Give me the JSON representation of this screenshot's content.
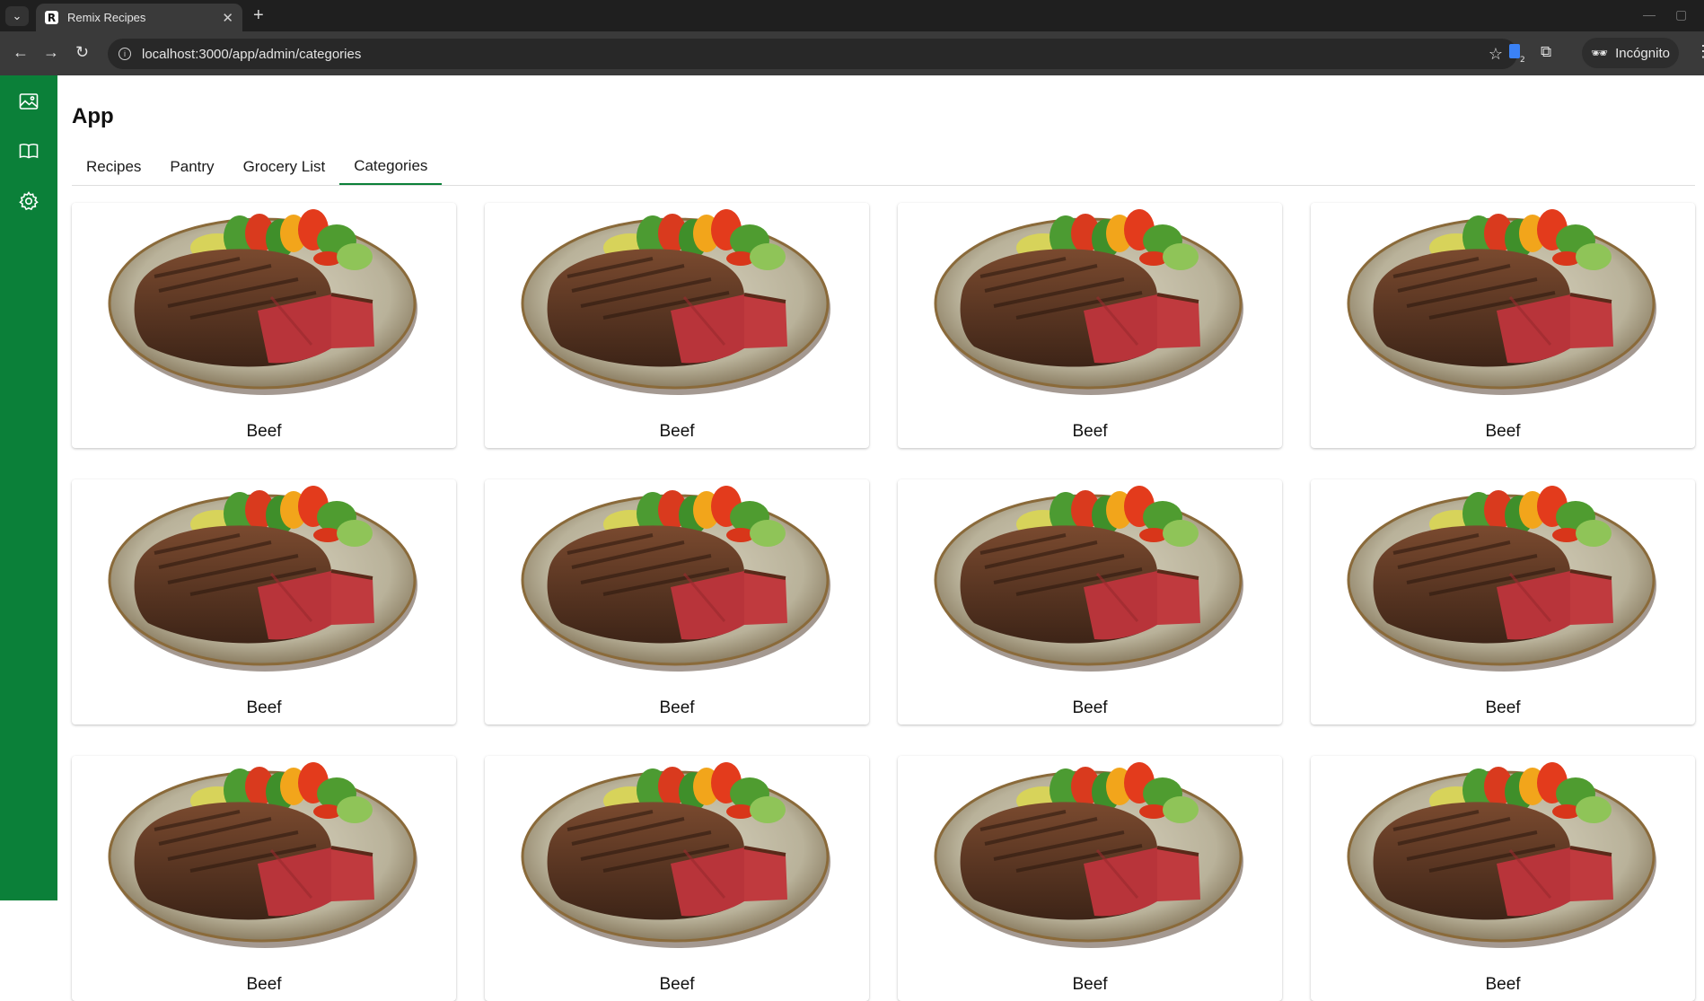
{
  "browser": {
    "tab_title": "Remix Recipes",
    "favicon_letter": "R",
    "url": "localhost:3000/app/admin/categories",
    "profile_label": "Incógnito",
    "extension_badge": "2"
  },
  "app": {
    "title": "App",
    "tabs": [
      {
        "label": "Recipes"
      },
      {
        "label": "Pantry"
      },
      {
        "label": "Grocery List"
      },
      {
        "label": "Categories",
        "active": true
      }
    ],
    "accent_color": "#0b8039"
  },
  "sidebar": {
    "icons": [
      "image-icon",
      "book-icon",
      "gear-icon"
    ]
  },
  "categories": [
    {
      "name": "Beef"
    },
    {
      "name": "Beef"
    },
    {
      "name": "Beef"
    },
    {
      "name": "Beef"
    },
    {
      "name": "Beef"
    },
    {
      "name": "Beef"
    },
    {
      "name": "Beef"
    },
    {
      "name": "Beef"
    },
    {
      "name": "Beef"
    },
    {
      "name": "Beef"
    },
    {
      "name": "Beef"
    },
    {
      "name": "Beef"
    }
  ]
}
